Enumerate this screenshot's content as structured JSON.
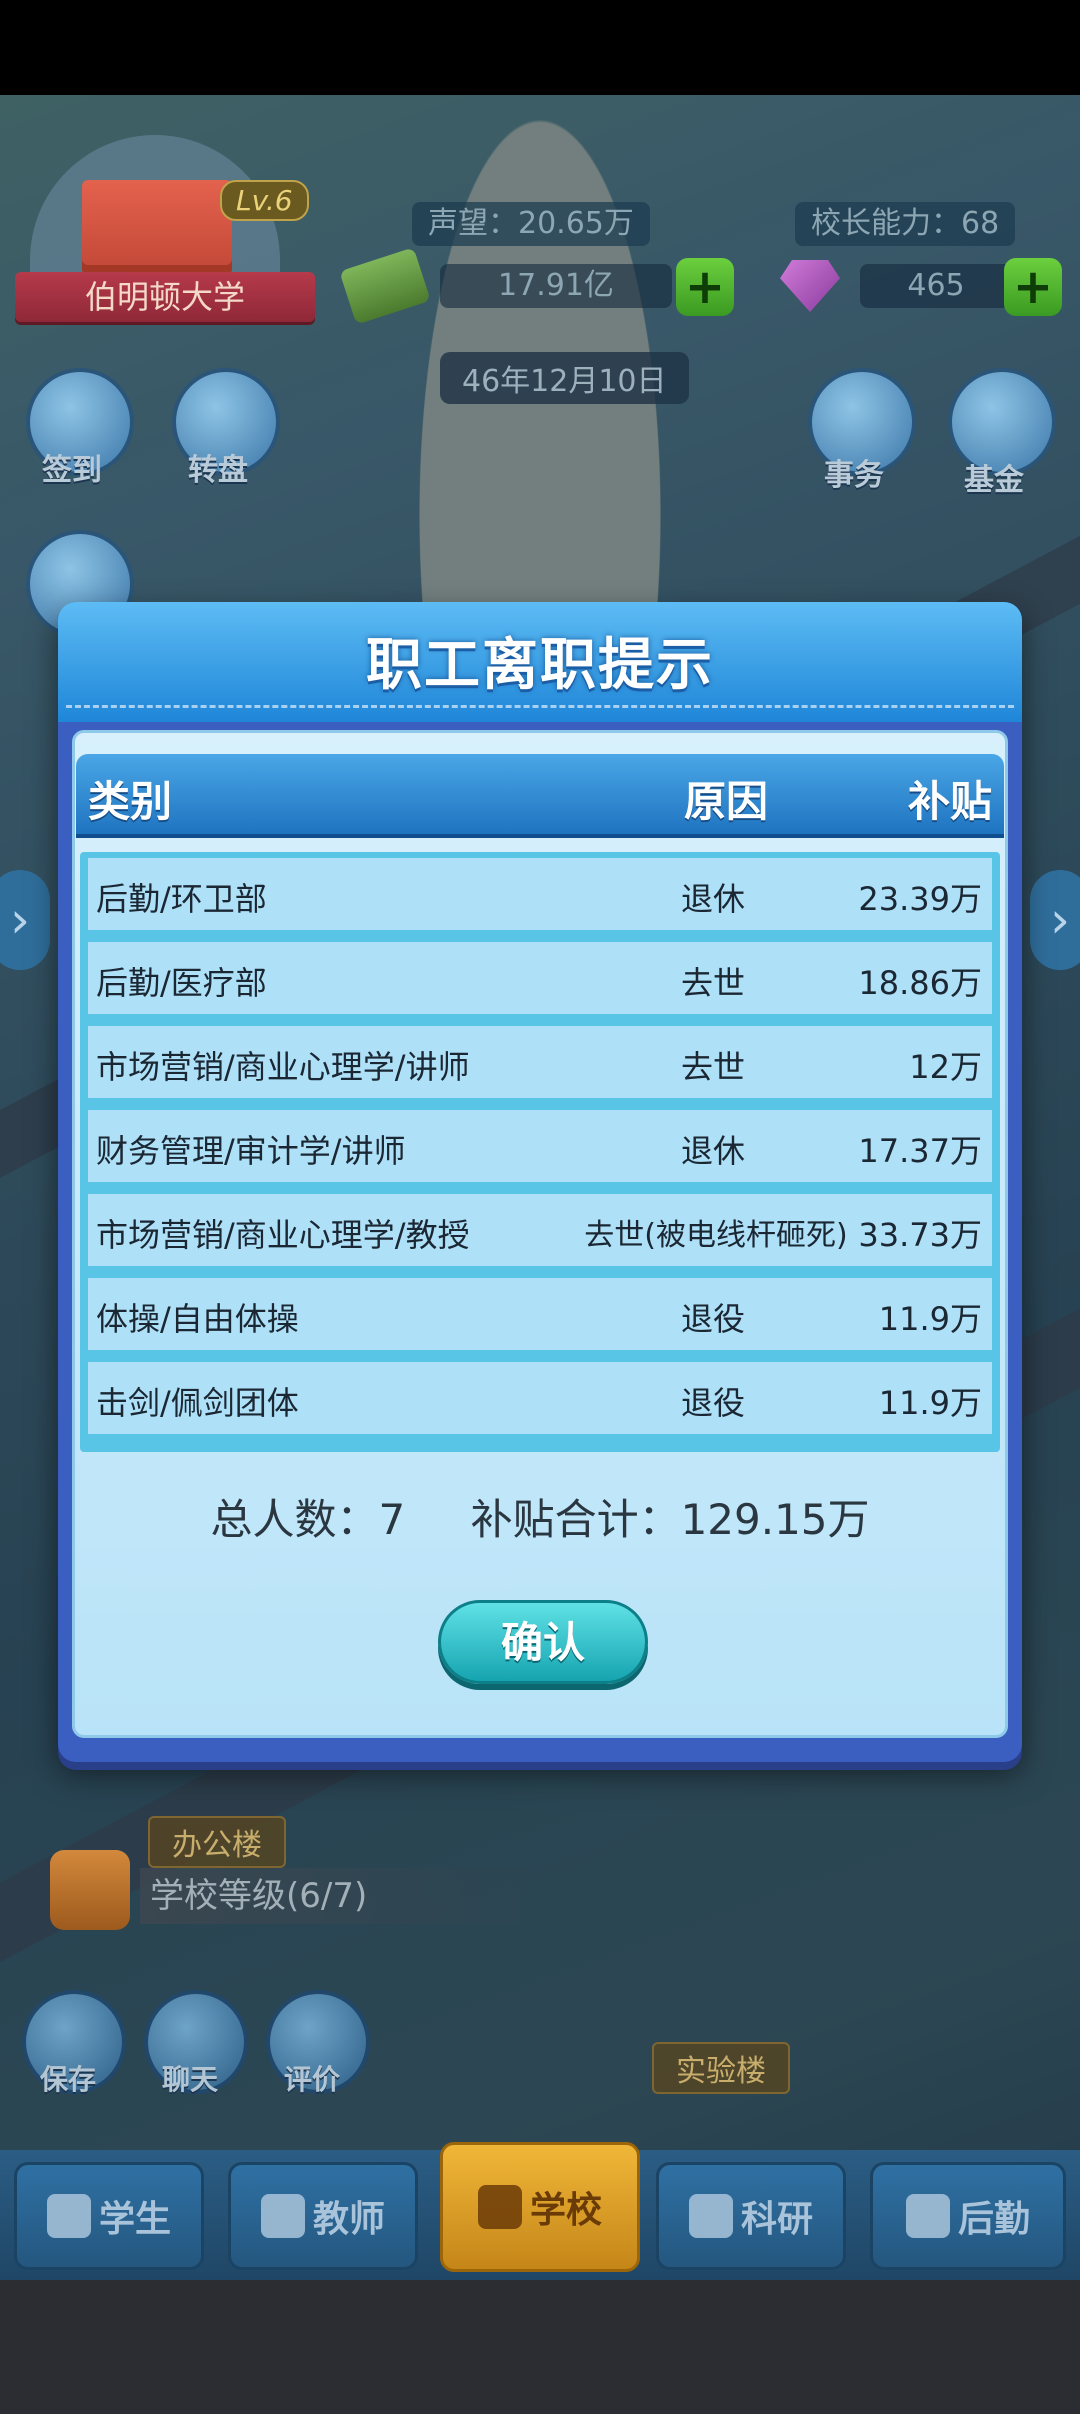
{
  "hud": {
    "level": "Lv.6",
    "university": "伯明顿大学",
    "reputation": "声望：20.65万",
    "principal_ability": "校长能力：68",
    "money": "17.91亿",
    "gems": "465",
    "date": "46年12月10日"
  },
  "side_buttons": {
    "checkin": "签到",
    "wheel": "转盘",
    "affairs": "事务",
    "fund": "基金"
  },
  "scene_labels": {
    "office": "办公楼",
    "school_level": "学校等级(6/7)",
    "lab": "实验楼"
  },
  "bottom_buttons": {
    "save": "保存",
    "chat": "聊天",
    "rate": "评价"
  },
  "nav": {
    "students": "学生",
    "teachers": "教师",
    "school": "学校",
    "research": "科研",
    "logistics": "后勤"
  },
  "modal": {
    "title": "职工离职提示",
    "columns": {
      "category": "类别",
      "reason": "原因",
      "subsidy": "补贴"
    },
    "rows": [
      {
        "category": "后勤/环卫部",
        "reason": "退休",
        "subsidy": "23.39万"
      },
      {
        "category": "后勤/医疗部",
        "reason": "去世",
        "subsidy": "18.86万"
      },
      {
        "category": "市场营销/商业心理学/讲师",
        "reason": "去世",
        "subsidy": "12万"
      },
      {
        "category": "财务管理/审计学/讲师",
        "reason": "退休",
        "subsidy": "17.37万"
      },
      {
        "category": "市场营销/商业心理学/教授",
        "reason": "去世(被电线杆砸死)",
        "subsidy": "33.73万"
      },
      {
        "category": "体操/自由体操",
        "reason": "退役",
        "subsidy": "11.9万"
      },
      {
        "category": "击剑/佩剑团体",
        "reason": "退役",
        "subsidy": "11.9万"
      }
    ],
    "total_people": "总人数：7",
    "total_subsidy": "补贴合计：129.15万",
    "confirm": "确认"
  }
}
